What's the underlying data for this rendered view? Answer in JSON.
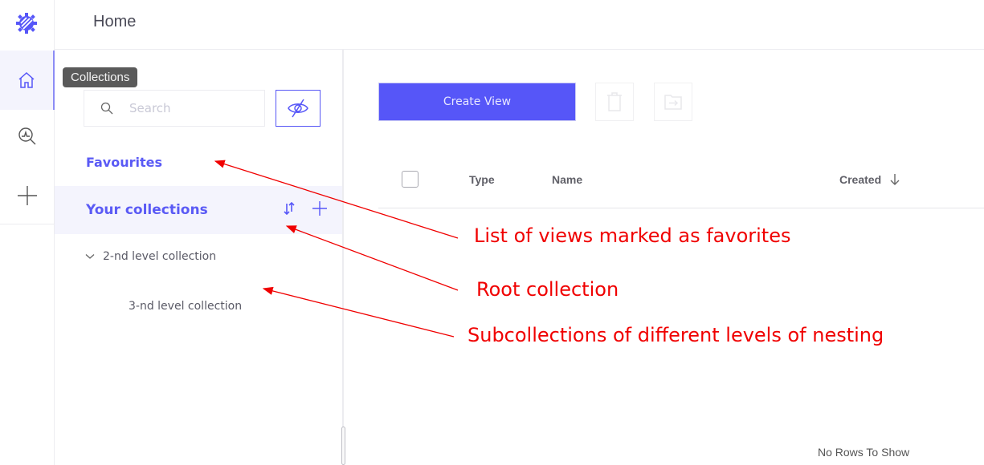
{
  "header": {
    "title": "Home"
  },
  "rail": {
    "items": [
      {
        "icon": "home-icon",
        "label": "Collections",
        "active": true
      },
      {
        "icon": "explore-icon",
        "label": "Explore"
      },
      {
        "icon": "plus-icon",
        "label": "Create"
      }
    ]
  },
  "tooltip": {
    "text": "Collections"
  },
  "collections": {
    "search_placeholder": "Search",
    "favourites_label": "Favourites",
    "root_label": "Your collections",
    "tree": [
      {
        "label": "2-nd level collection",
        "expanded": true,
        "level": 2
      },
      {
        "label": "3-nd level collection",
        "level": 3
      }
    ]
  },
  "main": {
    "create_view_label": "Create View",
    "table": {
      "columns": [
        "Type",
        "Name",
        "Created"
      ],
      "sort": {
        "column": "Created",
        "direction": "desc"
      },
      "empty_text": "No Rows To Show"
    }
  },
  "annotations": [
    "List of views marked as favorites",
    "Root collection",
    "Subcollections of different levels of nesting"
  ],
  "colors": {
    "accent": "#5656f8",
    "annotation": "#f00000"
  }
}
